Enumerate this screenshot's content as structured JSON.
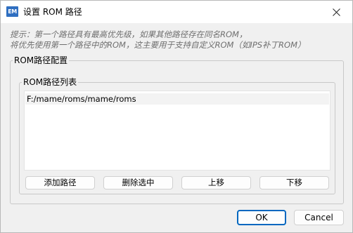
{
  "window": {
    "title": "设置 ROM 路径",
    "app_icon_text": "EM",
    "close_icon": "close-icon"
  },
  "hint": {
    "line1": "提示：第一个路径具有最高优先级，如果其他路径存在同名ROM，",
    "line2": "将优先使用第一个路径中的ROM，这主要用于支持自定义ROM（如IPS补丁ROM）"
  },
  "config_group": {
    "label": "ROM路径配置",
    "list_group": {
      "label": "ROM路径列表",
      "items": [
        "F:/mame/roms/mame/roms"
      ]
    },
    "buttons": {
      "add": "添加路径",
      "remove": "删除选中",
      "up": "上移",
      "down": "下移"
    }
  },
  "footer": {
    "ok": "OK",
    "cancel": "Cancel"
  },
  "colors": {
    "accent": "#0067c0",
    "app_icon": "#2f6fc1",
    "background": "#f0f0f0",
    "hint_text": "#6e6e6e"
  }
}
